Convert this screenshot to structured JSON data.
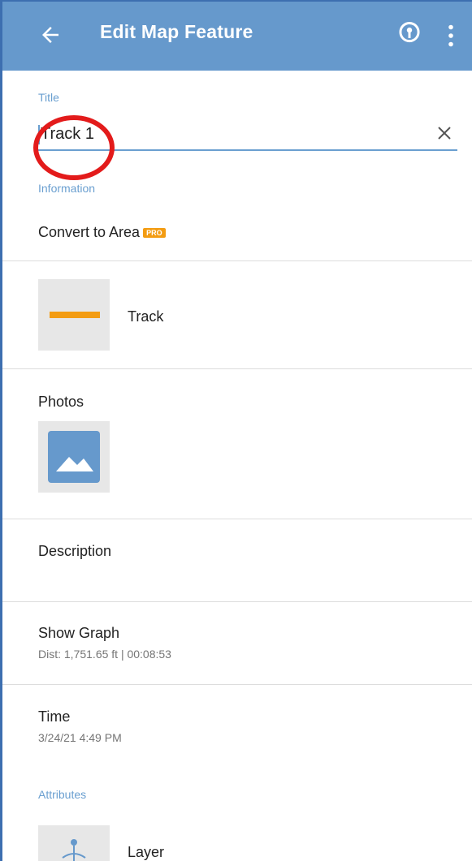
{
  "appbar": {
    "title": "Edit Map Feature",
    "back_icon": "arrow-left-icon",
    "pin_icon": "location-pin-icon",
    "more_icon": "more-vert-icon"
  },
  "title_section": {
    "label": "Title",
    "value": "Track 1",
    "clear_icon": "close-icon"
  },
  "information": {
    "label": "Information",
    "convert_label": "Convert to Area",
    "pro_badge": "PRO"
  },
  "style": {
    "label": "Track",
    "color": "#f39c12"
  },
  "photos": {
    "label": "Photos",
    "icon": "image-icon"
  },
  "description": {
    "label": "Description"
  },
  "graph": {
    "label": "Show Graph",
    "detail": "Dist: 1,751.65 ft | 00:08:53"
  },
  "time": {
    "label": "Time",
    "detail": "3/24/21 4:49 PM"
  },
  "attributes": {
    "label": "Attributes",
    "layer_label": "Layer"
  },
  "colors": {
    "appbar": "#6699cc",
    "accent": "#6a9fd0",
    "pro": "#f39c12",
    "annotation": "#e31b1b"
  }
}
